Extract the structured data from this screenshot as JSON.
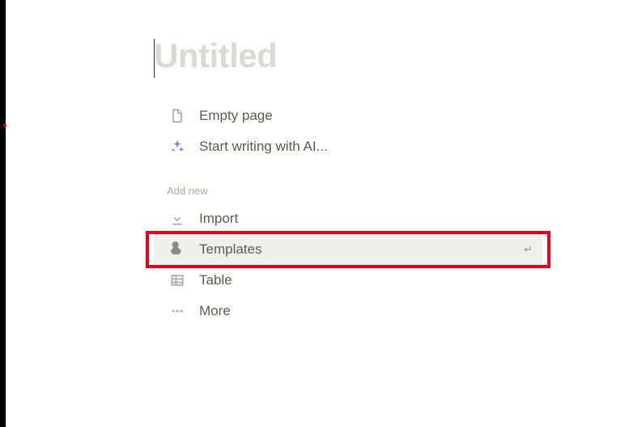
{
  "page": {
    "title_placeholder": "Untitled"
  },
  "options_top": [
    {
      "label": "Empty page"
    },
    {
      "label": "Start writing with AI..."
    }
  ],
  "section_heading": "Add new",
  "options_add": [
    {
      "label": "Import"
    },
    {
      "label": "Templates",
      "highlighted": true
    },
    {
      "label": "Table"
    },
    {
      "label": "More"
    }
  ]
}
